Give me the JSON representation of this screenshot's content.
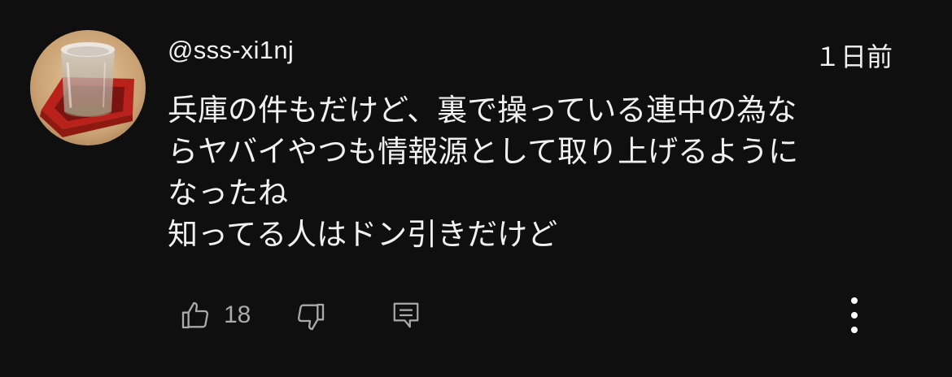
{
  "comment": {
    "author": "@sss-xi1nj",
    "timestamp": "１日前",
    "body_lines": [
      "兵庫の件もだけど、裏で操っている連中の為な",
      "らヤバイやつも情報源として取り上げるように",
      "なったね",
      "知ってる人はドン引きだけど"
    ],
    "avatar_icon": "avatar-image"
  },
  "actions": {
    "like_icon": "thumbs-up-icon",
    "like_count": "18",
    "dislike_icon": "thumbs-down-icon",
    "reply_icon": "reply-icon",
    "more_icon": "more-vert-icon"
  },
  "colors": {
    "background": "#0f0f0f",
    "text": "#f1f1f1",
    "muted": "#aaaaaa"
  }
}
